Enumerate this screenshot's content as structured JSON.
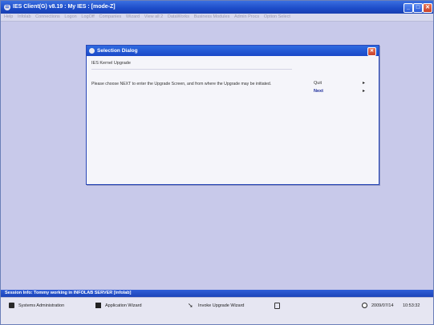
{
  "window": {
    "title": "IES Client(G) v8.19 : My IES :       [mode-Z]",
    "minimize_glyph": "_",
    "maximize_glyph": "□",
    "close_glyph": "✕"
  },
  "menu": [
    "Help",
    "Infolab",
    "Connections",
    "Logon",
    "LogOff",
    "Companies",
    "Wizard",
    "View all 2",
    "DataWorks",
    "Business Modules",
    "Admin Procs",
    "Option Select"
  ],
  "dialog": {
    "title": "Selection Dialog",
    "heading": "IES Kernel Upgrade",
    "message": "Please choose NEXT to enter the Upgrade Screen, and from where the Upgrade may be initiated.",
    "options": [
      {
        "label": "Quit",
        "arrow": "▸"
      },
      {
        "label": "Next",
        "arrow": "▸"
      }
    ],
    "close_glyph": "✕"
  },
  "session": {
    "text": "Session Info: Tommy working in INFOLAB SERVER   [infolab]"
  },
  "bottombar": {
    "items": [
      {
        "label": "Systems Administration",
        "icon": "book-icon"
      },
      {
        "label": "Application Wizard",
        "icon": "wizard-icon"
      },
      {
        "label": "Invoke Upgrade Wizard",
        "icon": "arrow-icon"
      },
      {
        "label": "",
        "icon": "document-icon"
      }
    ],
    "date": "2009/07/14",
    "time": "10:53:32"
  },
  "colors": {
    "titlebar": "#1c4bc8",
    "workspace": "#c8c9ea",
    "dialog_bg": "#f5f5fa",
    "accent_next": "#1a2a9a"
  }
}
